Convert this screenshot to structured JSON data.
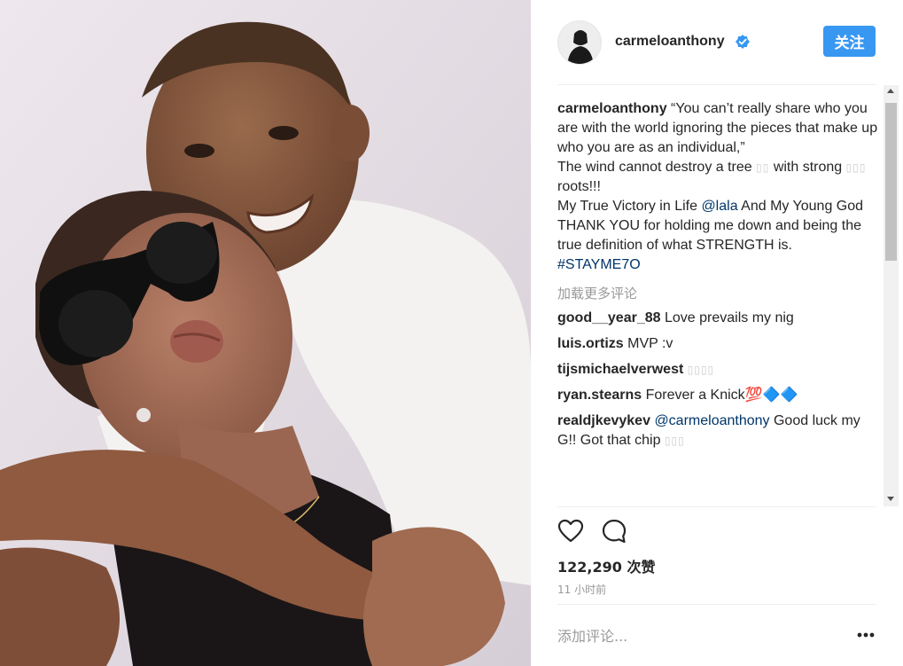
{
  "post": {
    "username": "carmeloanthony",
    "follow_label": "关注",
    "caption_user": "carmeloanthony",
    "caption_lines": [
      "“You can’t really share who you are with the world ignoring the pieces that make up who you are as an individual,”",
      "The wind cannot destroy a tree",
      "with strong",
      "roots!!!",
      "My True Victory in Life",
      "@lala",
      "And My Young God",
      "THANK YOU for holding me down and being the true definition of what STRENGTH is.",
      "#STAYME7O"
    ],
    "load_more": "加载更多评论",
    "comments": [
      {
        "user": "good__year_88",
        "text": "Love prevails my nig"
      },
      {
        "user": "luis.ortizs",
        "text": "MVP :v"
      },
      {
        "user": "tijsmichaelverwest",
        "text": ""
      },
      {
        "user": "ryan.stearns",
        "text": "Forever a Knick💯🔷🔷"
      },
      {
        "user": "realdjkevykev",
        "mention": "@carmeloanthony",
        "text": "Good luck my G!! Got that chip"
      }
    ],
    "likes": "122,290 次赞",
    "time": "11 小时前",
    "comment_placeholder": "添加评论...",
    "more_icon": "more-icon"
  },
  "colors": {
    "accent": "#3897f0",
    "verified": "#3897f0",
    "tag": "#003569",
    "muted": "#999999"
  }
}
